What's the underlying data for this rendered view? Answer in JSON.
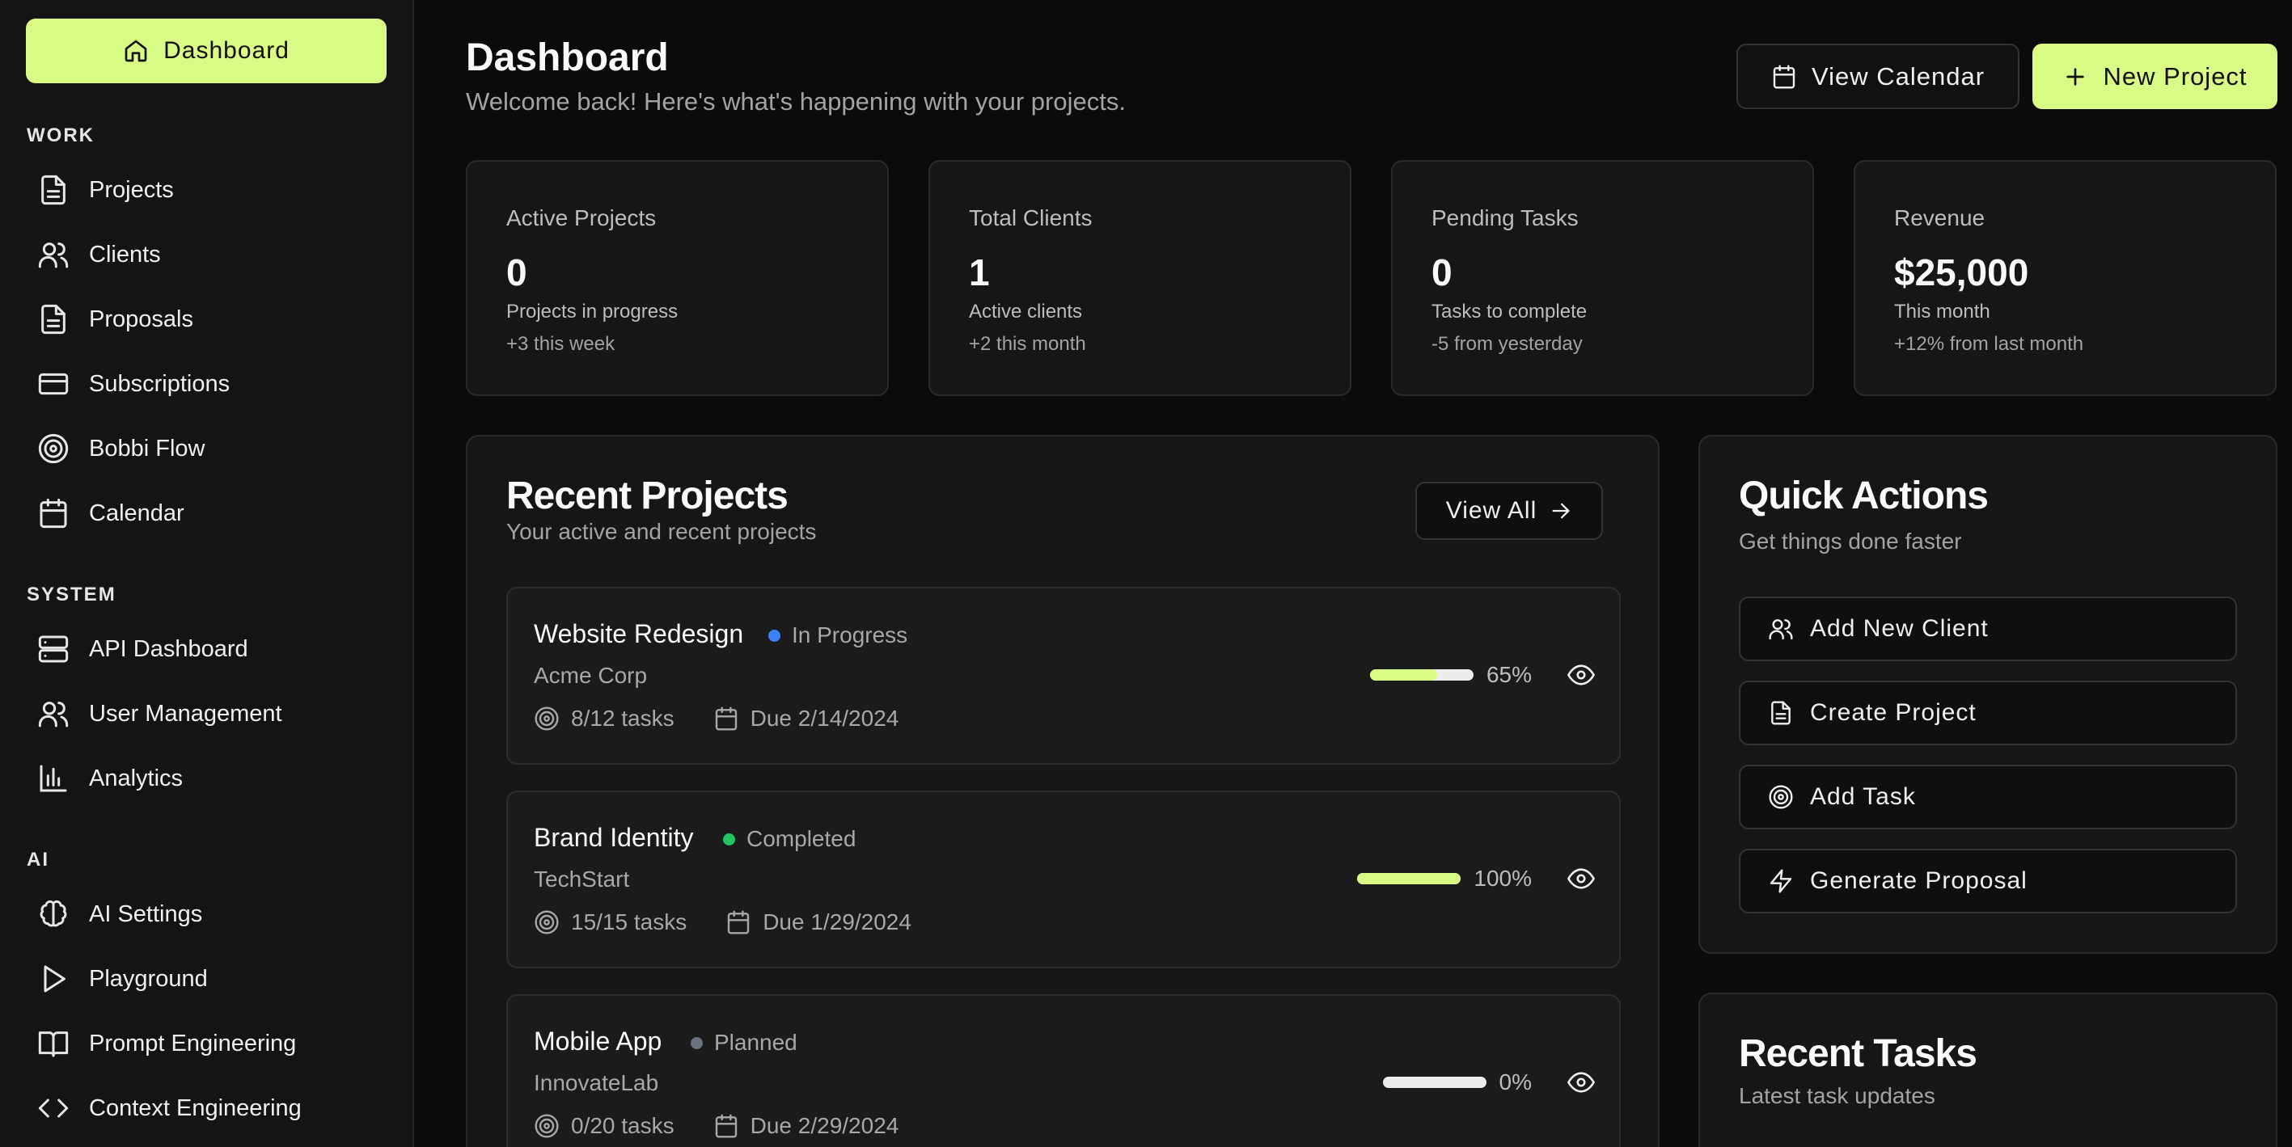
{
  "sidebar": {
    "dashboard_label": "Dashboard",
    "sections": [
      {
        "label": "WORK",
        "items": [
          {
            "label": "Projects",
            "icon": "file-text-icon"
          },
          {
            "label": "Clients",
            "icon": "users-icon"
          },
          {
            "label": "Proposals",
            "icon": "file-text-icon"
          },
          {
            "label": "Subscriptions",
            "icon": "credit-card-icon"
          },
          {
            "label": "Bobbi Flow",
            "icon": "target-icon"
          },
          {
            "label": "Calendar",
            "icon": "calendar-icon"
          }
        ]
      },
      {
        "label": "SYSTEM",
        "items": [
          {
            "label": "API Dashboard",
            "icon": "server-icon"
          },
          {
            "label": "User Management",
            "icon": "users-icon"
          },
          {
            "label": "Analytics",
            "icon": "bar-chart-icon"
          }
        ]
      },
      {
        "label": "AI",
        "items": [
          {
            "label": "AI Settings",
            "icon": "brain-icon"
          },
          {
            "label": "Playground",
            "icon": "play-icon"
          },
          {
            "label": "Prompt Engineering",
            "icon": "book-open-icon"
          },
          {
            "label": "Context Engineering",
            "icon": "code-icon"
          }
        ]
      }
    ]
  },
  "header": {
    "title": "Dashboard",
    "subtitle": "Welcome back! Here's what's happening with your projects.",
    "view_calendar_label": "View Calendar",
    "new_project_label": "New Project"
  },
  "stats": [
    {
      "label": "Active Projects",
      "value": "0",
      "desc": "Projects in progress",
      "change": "+3 this week"
    },
    {
      "label": "Total Clients",
      "value": "1",
      "desc": "Active clients",
      "change": "+2 this month"
    },
    {
      "label": "Pending Tasks",
      "value": "0",
      "desc": "Tasks to complete",
      "change": "-5 from yesterday"
    },
    {
      "label": "Revenue",
      "value": "$25,000",
      "desc": "This month",
      "change": "+12% from last month"
    }
  ],
  "recent_projects": {
    "title": "Recent Projects",
    "subtitle": "Your active and recent projects",
    "view_all_label": "View All",
    "items": [
      {
        "name": "Website Redesign",
        "status": "In Progress",
        "status_color": "#3b82f6",
        "client": "Acme Corp",
        "tasks": "8/12 tasks",
        "due": "Due 2/14/2024",
        "progress": 65,
        "progress_label": "65%"
      },
      {
        "name": "Brand Identity",
        "status": "Completed",
        "status_color": "#22c55e",
        "client": "TechStart",
        "tasks": "15/15 tasks",
        "due": "Due 1/29/2024",
        "progress": 100,
        "progress_label": "100%"
      },
      {
        "name": "Mobile App",
        "status": "Planned",
        "status_color": "#6b7280",
        "client": "InnovateLab",
        "tasks": "0/20 tasks",
        "due": "Due 2/29/2024",
        "progress": 0,
        "progress_label": "0%"
      }
    ]
  },
  "quick_actions": {
    "title": "Quick Actions",
    "subtitle": "Get things done faster",
    "items": [
      {
        "label": "Add New Client",
        "icon": "users-icon"
      },
      {
        "label": "Create Project",
        "icon": "file-text-icon"
      },
      {
        "label": "Add Task",
        "icon": "target-icon"
      },
      {
        "label": "Generate Proposal",
        "icon": "zap-icon"
      }
    ]
  },
  "recent_tasks": {
    "title": "Recent Tasks",
    "subtitle": "Latest task updates"
  },
  "colors": {
    "accent": "#d9fb86",
    "background": "#0b0b0b",
    "card": "#161616"
  }
}
